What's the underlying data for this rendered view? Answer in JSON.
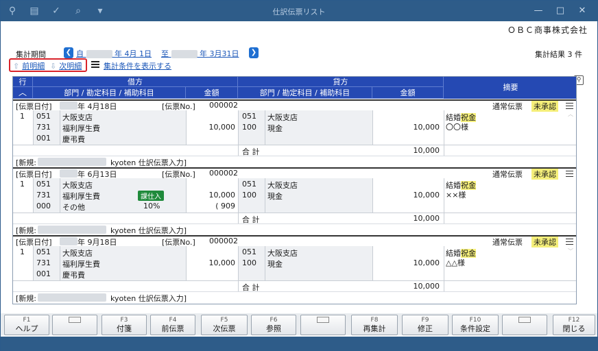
{
  "window": {
    "title": "仕訳伝票リスト",
    "buttons": [
      "—",
      "□",
      "✕"
    ]
  },
  "header": {
    "company": "ＯＢＣ商事株式会社",
    "period_label": "集計期間",
    "period_from_prefix": "自",
    "period_from_suffix": "年  4月 1日",
    "period_to_prefix": "至",
    "period_to_suffix": "年  3月31日",
    "result": "集計結果 3 件",
    "prev_detail": "前明細",
    "next_detail": "次明細",
    "show_conditions": "集計条件を表示する"
  },
  "columns": {
    "row": "行",
    "debit": "借方",
    "credit": "貸方",
    "dept_account": "部門 / 勘定科目 / 補助科目",
    "amount": "金額",
    "summary": "摘要"
  },
  "records": [
    {
      "date_label": "[伝票日付]",
      "date_suffix": "年  4月18日",
      "no_label": "[伝票No.]",
      "no": "000002",
      "type": "通常伝票",
      "status": "未承認",
      "row": "1",
      "debit_codes": [
        "051",
        "731",
        "001"
      ],
      "debit_names": [
        "大阪支店",
        "福利厚生費",
        "慶弔費"
      ],
      "debit_tax": "",
      "debit_rate": "",
      "debit_amount": "10,000",
      "debit_tax_amount": "",
      "credit_codes": [
        "051",
        "100"
      ],
      "credit_names": [
        "大阪支店",
        "現金"
      ],
      "credit_amount": "10,000",
      "summary_pre": "結婚",
      "summary_hl": "祝金",
      "summary_line2": "〇〇様",
      "total_label": "合  計",
      "total": "10,000",
      "new_label": "[新規:",
      "new_suffix": "kyoten  仕訳伝票入力]"
    },
    {
      "date_label": "[伝票日付]",
      "date_suffix": "年  6月13日",
      "no_label": "[伝票No.]",
      "no": "000002",
      "type": "通常伝票",
      "status": "未承認",
      "row": "1",
      "debit_codes": [
        "051",
        "731",
        "000"
      ],
      "debit_names": [
        "大阪支店",
        "福利厚生費",
        "その他"
      ],
      "debit_tax": "課仕入",
      "debit_rate": "10%",
      "debit_amount": "10,000",
      "debit_tax_amount": "( 909",
      "credit_codes": [
        "051",
        "100"
      ],
      "credit_names": [
        "大阪支店",
        "現金"
      ],
      "credit_amount": "10,000",
      "summary_pre": "結婚",
      "summary_hl": "祝金",
      "summary_line2": "××様",
      "total_label": "合  計",
      "total": "10,000",
      "new_label": "[新規:",
      "new_suffix": "kyoten  仕訳伝票入力]"
    },
    {
      "date_label": "[伝票日付]",
      "date_suffix": "年  9月18日",
      "no_label": "[伝票No.]",
      "no": "000002",
      "type": "通常伝票",
      "status": "未承認",
      "row": "1",
      "debit_codes": [
        "051",
        "731",
        "001"
      ],
      "debit_names": [
        "大阪支店",
        "福利厚生費",
        "慶弔費"
      ],
      "debit_tax": "",
      "debit_rate": "",
      "debit_amount": "10,000",
      "debit_tax_amount": "",
      "credit_codes": [
        "051",
        "100"
      ],
      "credit_names": [
        "大阪支店",
        "現金"
      ],
      "credit_amount": "10,000",
      "summary_pre": "結婚",
      "summary_hl": "祝金",
      "summary_line2": "△△様",
      "total_label": "合  計",
      "total": "10,000",
      "new_label": "[新規:",
      "new_suffix": "kyoten  仕訳伝票入力]"
    }
  ],
  "fkeys": [
    {
      "key": "F1",
      "label": "ヘルプ"
    },
    {
      "key": "",
      "label": ""
    },
    {
      "key": "F3",
      "label": "付箋"
    },
    {
      "key": "F4",
      "label": "前伝票"
    },
    {
      "key": "F5",
      "label": "次伝票"
    },
    {
      "key": "F6",
      "label": "参照"
    },
    {
      "key": "",
      "label": ""
    },
    {
      "key": "F8",
      "label": "再集計"
    },
    {
      "key": "F9",
      "label": "修正"
    },
    {
      "key": "F10",
      "label": "条件設定"
    },
    {
      "key": "",
      "label": ""
    },
    {
      "key": "F12",
      "label": "閉じる"
    }
  ]
}
